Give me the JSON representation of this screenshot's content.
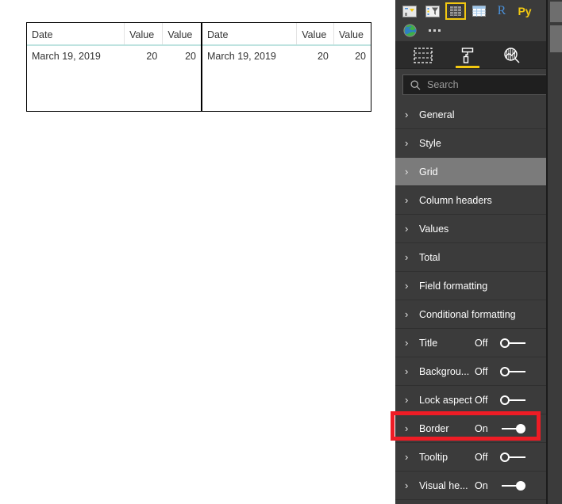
{
  "canvas": {
    "visuals": [
      {
        "name": "table-visual-left",
        "columns": [
          "Date",
          "Value",
          "Value"
        ],
        "rows": [
          [
            "March 19, 2019",
            "20",
            "20"
          ]
        ]
      },
      {
        "name": "table-visual-right",
        "columns": [
          "Date",
          "Value",
          "Value"
        ],
        "rows": [
          [
            "March 19, 2019",
            "20",
            "20"
          ]
        ]
      }
    ]
  },
  "pane": {
    "gallery": {
      "icons": [
        {
          "name": "card-chart-icon",
          "label": "Card",
          "selected": false
        },
        {
          "name": "slicer-icon",
          "label": "Slicer",
          "selected": false
        },
        {
          "name": "table-icon",
          "label": "Table",
          "selected": true
        },
        {
          "name": "matrix-icon",
          "label": "Matrix",
          "selected": false
        },
        {
          "name": "r-script-visual-icon",
          "label": "R",
          "selected": false
        },
        {
          "name": "python-visual-icon",
          "label": "Py",
          "selected": false
        }
      ],
      "icons_row2": [
        {
          "name": "arcgis-map-icon",
          "label": "ArcGIS Map",
          "selected": false
        },
        {
          "name": "more-options-icon",
          "label": "...",
          "selected": false
        }
      ]
    },
    "tabs": [
      {
        "name": "tab-fields",
        "icon": "fields-icon",
        "label": "Fields",
        "active": false
      },
      {
        "name": "tab-format",
        "icon": "paint-roller-icon",
        "label": "Format",
        "active": true
      },
      {
        "name": "tab-analytics",
        "icon": "analytics-magnifier-icon",
        "label": "Analytics",
        "active": false
      }
    ],
    "search": {
      "icon": "search-icon",
      "placeholder": "Search",
      "value": ""
    },
    "properties": [
      {
        "label": "General",
        "state": null,
        "toggle": null,
        "hover": false,
        "highlighted": false
      },
      {
        "label": "Style",
        "state": null,
        "toggle": null,
        "hover": false,
        "highlighted": false
      },
      {
        "label": "Grid",
        "state": null,
        "toggle": null,
        "hover": true,
        "highlighted": false
      },
      {
        "label": "Column headers",
        "state": null,
        "toggle": null,
        "hover": false,
        "highlighted": false
      },
      {
        "label": "Values",
        "state": null,
        "toggle": null,
        "hover": false,
        "highlighted": false
      },
      {
        "label": "Total",
        "state": null,
        "toggle": null,
        "hover": false,
        "highlighted": false
      },
      {
        "label": "Field formatting",
        "state": null,
        "toggle": null,
        "hover": false,
        "highlighted": false
      },
      {
        "label": "Conditional formatting",
        "state": null,
        "toggle": null,
        "hover": false,
        "highlighted": false
      },
      {
        "label": "Title",
        "state": "Off",
        "toggle": "off",
        "hover": false,
        "highlighted": false
      },
      {
        "label": "Backgrou...",
        "state": "Off",
        "toggle": "off",
        "hover": false,
        "highlighted": false
      },
      {
        "label": "Lock aspect",
        "state": "Off",
        "toggle": "off",
        "hover": false,
        "highlighted": false
      },
      {
        "label": "Border",
        "state": "On",
        "toggle": "on",
        "hover": false,
        "highlighted": true
      },
      {
        "label": "Tooltip",
        "state": "Off",
        "toggle": "off",
        "hover": false,
        "highlighted": false
      },
      {
        "label": "Visual he...",
        "state": "On",
        "toggle": "on",
        "hover": false,
        "highlighted": false
      }
    ]
  },
  "colors": {
    "pane_background": "#3b3b3b",
    "pane_tabs_background": "#2b2b2b",
    "accent_yellow": "#f2c811",
    "hover_row": "#7b7b7b",
    "highlight_red": "#ee1c25",
    "table_header_underline": "#bfe3e0",
    "table_text": "#333333"
  }
}
